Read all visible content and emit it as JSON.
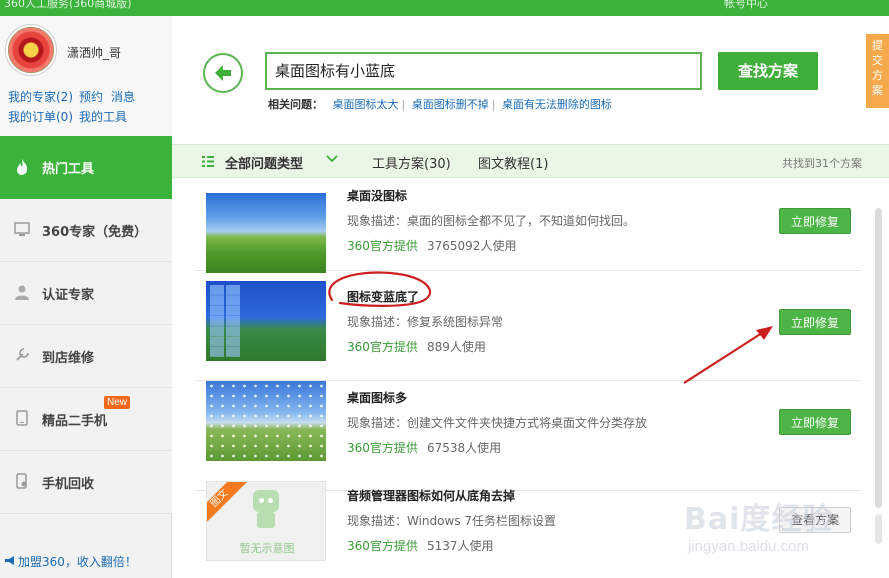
{
  "window": {
    "title": "360人工服务(360商城版)",
    "top_right": "帐号中心"
  },
  "profile": {
    "username": "潇洒帅_哥",
    "links": [
      "我的专家(2)",
      "预约",
      "消息",
      "我的订单(0)",
      "我的工具"
    ]
  },
  "sidebar": {
    "items": [
      {
        "label": "热门工具",
        "icon": "fire-icon"
      },
      {
        "label": "360专家（免费）",
        "icon": "monitor-icon"
      },
      {
        "label": "认证专家",
        "icon": "person-icon"
      },
      {
        "label": "到店维修",
        "icon": "wrench-icon"
      },
      {
        "label": "精品二手机",
        "icon": "phone-icon",
        "badge": "New"
      },
      {
        "label": "手机回收",
        "icon": "phone-recycle-icon"
      }
    ],
    "join": "加盟360，收入翻倍！"
  },
  "search": {
    "value": "桌面图标有小蓝底",
    "button": "查找方案",
    "related_label": "相关问题：",
    "related": [
      "桌面图标太大",
      "桌面图标删不掉",
      "桌面有无法删除的图标"
    ]
  },
  "submit_tab": "提交方案",
  "filter": {
    "type_label": "全部问题类型",
    "tab_tools": "工具方案(30)",
    "tab_tutorial": "图文教程(1)",
    "found": "共找到31个方案"
  },
  "results": [
    {
      "title": "桌面没图标",
      "desc": "现象描述：桌面的图标全都不见了，不知道如何找回。",
      "source": "360官方提供",
      "users": "3765092人使用",
      "action": "立即修复"
    },
    {
      "title": "图标变蓝底了",
      "desc": "现象描述：修复系统图标异常",
      "source": "360官方提供",
      "users": "889人使用",
      "action": "立即修复"
    },
    {
      "title": "桌面图标多",
      "desc": "现象描述：创建文件文件夹快捷方式将桌面文件分类存放",
      "source": "360官方提供",
      "users": "67538人使用",
      "action": "立即修复"
    },
    {
      "title": "音频管理器图标如何从底角去掉",
      "desc": "现象描述：Windows 7任务栏图标设置",
      "source": "360官方提供",
      "users": "5137人使用",
      "action": "查看方案",
      "ribbon": "图文",
      "no_image": "暂无示意图"
    }
  ],
  "watermark": {
    "brand": "Bai度经验",
    "url": "jingyan.baidu.com"
  },
  "colors": {
    "brand_green": "#3bb33a",
    "link_blue": "#1a6bb5",
    "orange": "#f6a94a",
    "annotation_red": "#cc1f1f"
  }
}
